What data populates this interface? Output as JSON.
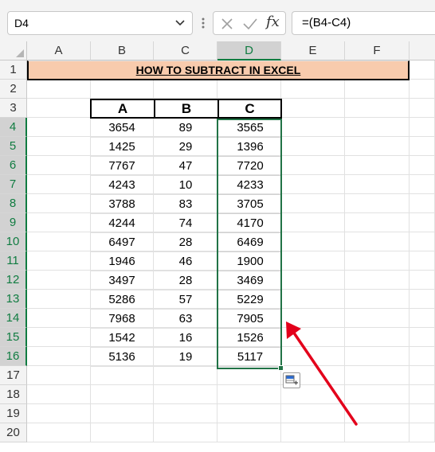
{
  "formula_bar": {
    "name_box": "D4",
    "formula": "=(B4-C4)",
    "fx_label": "fx"
  },
  "columns": [
    "A",
    "B",
    "C",
    "D",
    "E",
    "F"
  ],
  "rows": [
    "1",
    "2",
    "3",
    "4",
    "5",
    "6",
    "7",
    "8",
    "9",
    "10",
    "11",
    "12",
    "13",
    "14",
    "15",
    "16",
    "17",
    "18",
    "19",
    "20"
  ],
  "sheet": {
    "title": "HOW TO SUBTRACT IN EXCEL",
    "table_headers": [
      "A",
      "B",
      "C"
    ],
    "table_rows": [
      [
        "3654",
        "89",
        "3565"
      ],
      [
        "1425",
        "29",
        "1396"
      ],
      [
        "7767",
        "47",
        "7720"
      ],
      [
        "4243",
        "10",
        "4233"
      ],
      [
        "3788",
        "83",
        "3705"
      ],
      [
        "4244",
        "74",
        "4170"
      ],
      [
        "6497",
        "28",
        "6469"
      ],
      [
        "1946",
        "46",
        "1900"
      ],
      [
        "3497",
        "28",
        "3469"
      ],
      [
        "5286",
        "57",
        "5229"
      ],
      [
        "7968",
        "63",
        "7905"
      ],
      [
        "1542",
        "16",
        "1526"
      ],
      [
        "5136",
        "19",
        "5117"
      ]
    ]
  },
  "colors": {
    "title_fill": "#f8cbad",
    "selection": "#217346",
    "selected_fill": "#c6c6c6",
    "arrow": "#e3001b"
  }
}
